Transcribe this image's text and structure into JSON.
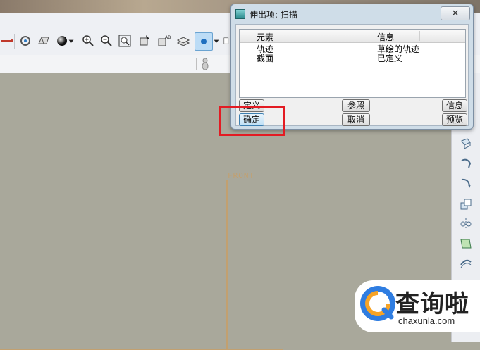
{
  "toolbar": {
    "icons": [
      "sketch-line-icon",
      "gear-icon",
      "hat-icon",
      "sphere-icon",
      "chevron-down-icon",
      "zoom-in-icon",
      "zoom-out-icon",
      "zoom-fit-icon",
      "datum-cursor-icon",
      "datum-axis-icon",
      "layer-icon",
      "display-style-icon",
      "chevron-down-icon",
      "more-icon"
    ]
  },
  "dialog": {
    "title": "伸出项: 扫描",
    "close_glyph": "✕",
    "columns": [
      "元素",
      "信息"
    ],
    "rows": [
      {
        "element": "轨迹",
        "info": "草绘的轨迹"
      },
      {
        "element": "截面",
        "info": "已定义"
      }
    ],
    "buttons": {
      "define": "定义",
      "refs": "参照",
      "info": "信息",
      "ok": "确定",
      "cancel": "取消",
      "preview": "预览"
    }
  },
  "canvas": {
    "plane_label": "FRONT"
  },
  "watermark": {
    "cn": "查询啦",
    "en": "chaxunla.com"
  },
  "colors": {
    "highlight": "#e31b23",
    "plane": "#c2a070",
    "background": "#a9a89b"
  }
}
